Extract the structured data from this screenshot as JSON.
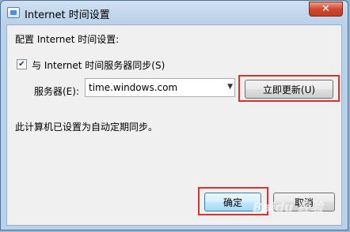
{
  "window": {
    "title": "Internet 时间设置",
    "close_glyph": "✕",
    "title_icon": "clock-settings-icon"
  },
  "dialog": {
    "heading": "配置 Internet 时间设置:",
    "sync_checkbox": {
      "checked": true,
      "label": "与 Internet 时间服务器同步(S)"
    },
    "server": {
      "label": "服务器(E):",
      "value": "time.windows.com"
    },
    "update_now_label": "立即更新(U)",
    "status_text": "此计算机已设置为自动定期同步。",
    "ok_label": "确定",
    "cancel_label": "取消",
    "highlight_color": "#d9312b"
  },
  "watermark": "Baidu 经验"
}
